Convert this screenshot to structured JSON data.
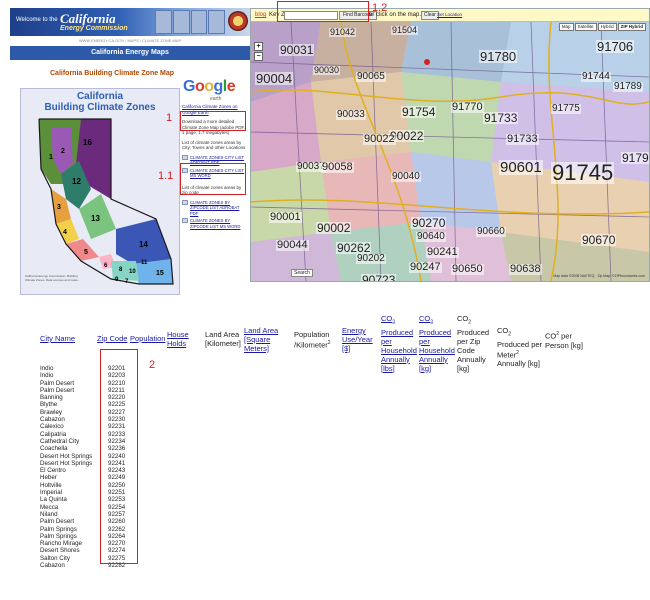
{
  "cec_page": {
    "banner_welcome": "Welcome to the",
    "banner_org_line1": "California",
    "banner_org_line2": "Energy Commission",
    "breadcrumb": "WWW.ENERGY.CA.GOV / MAPS / CLIMATE ZONE MAP",
    "section_title": "California Energy Maps",
    "map_title": "California Building Climate Zone Map",
    "map_heading_line1": "California",
    "map_heading_line2": "Building Climate Zones",
    "zone_numbers": [
      "1",
      "2",
      "3",
      "4",
      "5",
      "6",
      "7",
      "8",
      "9",
      "10",
      "11",
      "12",
      "13",
      "14",
      "15",
      "16"
    ],
    "map_note": "California Energy Commission. Building Climate Zones. Data sources and notes.",
    "google_logo": [
      "G",
      "o",
      "o",
      "g",
      "l",
      "e"
    ],
    "google_sub": "earth",
    "google_link": "California Climate Zones on Google Earth",
    "download_text": "Download a more detailed Climate Zone Map (adobe PDF, 1 page, 1.7 megabytes)",
    "list_text": "List of climate zones areas by City, Towns and other Locations",
    "links_a": [
      "CLIMATE ZONES CITY LIST ADROBAT PDF",
      "CLIMATE ZONES CITY LIST MS WORD"
    ],
    "zip_text": "List of climate zones areas by zip code",
    "links_b": [
      "CLIMATE ZONES BY ZIPCODE LIST ADROBAT PDF",
      "CLIMATE ZONES BY ZIPCODE LIST MS WORD"
    ]
  },
  "callouts": {
    "c1": "1",
    "c11": "1.1",
    "c12": "1.2",
    "c2": "2"
  },
  "zip_map": {
    "blog": "blog",
    "key_label": "Key Zip",
    "find_button": "Find Barcode",
    "or_click": "or click on the map.",
    "clear_button": "Clear",
    "set_location": "Set Location",
    "map_types": [
      "Map",
      "Satellite",
      "Hybrid",
      "ZIP Hybrid"
    ],
    "search_button": "Search",
    "credit": "Map data ©2008 NAVTEQ · Zip Map: ©ZIPboundaries.com",
    "zip_labels": [
      "91042",
      "91504",
      "91706",
      "90031",
      "91780",
      "91744",
      "91789",
      "90004",
      "90030",
      "91754",
      "91770",
      "91733",
      "90022",
      "91775",
      "90037",
      "90058",
      "90040",
      "90601",
      "91745",
      "91733",
      "90001",
      "90002",
      "90270",
      "90660",
      "90044",
      "90202",
      "90262",
      "90241",
      "90247",
      "90670",
      "90638",
      "90640",
      "90650",
      "90723",
      "90022",
      "90033",
      "90065",
      "91790"
    ]
  },
  "table": {
    "headers": {
      "city": "City Name",
      "zip": "Zip Code",
      "population": "Population",
      "households": "House Holds",
      "land_area_a": "Land Area",
      "land_area_a_unit": "[Kilometer]",
      "land_area_b": "Land Area",
      "land_area_b_unit": "[Square Meters]",
      "pop_density": "Population",
      "pop_density_unit": "/Kilometer",
      "energy_use": "Energy Use/Year [$]",
      "co2_hh_lbs": "Produced per Household Annually [lbs]",
      "co2_hh_kg": "Produced per Household Annually [kg]",
      "co2_zip": "Produced per Zip Code Annually [kg]",
      "co2_meter": "Produced per Meter",
      "co2_meter_unit": "Annually [kg]",
      "co2_person": "per Person [kg]",
      "co2_prefix": "CO"
    },
    "rows": [
      {
        "city": "Indio",
        "zip": "92201"
      },
      {
        "city": "Indio",
        "zip": "92203"
      },
      {
        "city": "Palm Desert",
        "zip": "92210"
      },
      {
        "city": "Palm Desert",
        "zip": "92211"
      },
      {
        "city": "Banning",
        "zip": "92220"
      },
      {
        "city": "Blythe",
        "zip": "92225"
      },
      {
        "city": "Brawley",
        "zip": "92227"
      },
      {
        "city": "Cabazon",
        "zip": "92230"
      },
      {
        "city": "Calexico",
        "zip": "92231"
      },
      {
        "city": "Calipatria",
        "zip": "92233"
      },
      {
        "city": "Cathedral City",
        "zip": "92234"
      },
      {
        "city": "Coachella",
        "zip": "92236"
      },
      {
        "city": "Desert Hot Springs",
        "zip": "92240"
      },
      {
        "city": "Desert Hot Springs",
        "zip": "92241"
      },
      {
        "city": "El Centro",
        "zip": "92243"
      },
      {
        "city": "Heber",
        "zip": "92249"
      },
      {
        "city": "Holtville",
        "zip": "92250"
      },
      {
        "city": "Imperial",
        "zip": "92251"
      },
      {
        "city": "La Quinta",
        "zip": "92253"
      },
      {
        "city": "Mecca",
        "zip": "92254"
      },
      {
        "city": "Niland",
        "zip": "92257"
      },
      {
        "city": "Palm Desert",
        "zip": "92260"
      },
      {
        "city": "Palm Springs",
        "zip": "92262"
      },
      {
        "city": "Palm Springs",
        "zip": "92264"
      },
      {
        "city": "Rancho Mirage",
        "zip": "92270"
      },
      {
        "city": "Desert Shores",
        "zip": "92274"
      },
      {
        "city": "Salton City",
        "zip": "92275"
      },
      {
        "city": "Cabazon",
        "zip": "92282"
      }
    ]
  },
  "colors": {
    "callout": "#d42020",
    "link": "#1a1aa6",
    "cec_blue": "#2c5aa8"
  }
}
